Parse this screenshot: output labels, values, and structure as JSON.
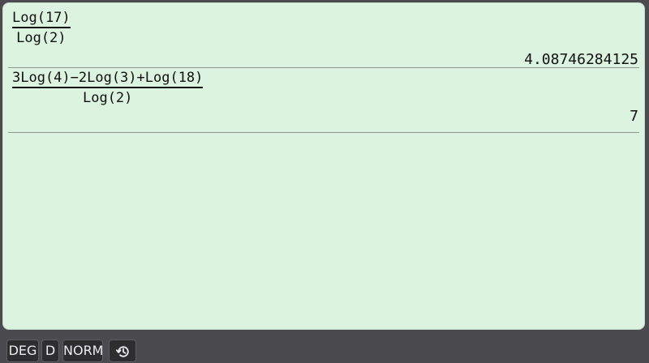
{
  "history": [
    {
      "numerator": "Log(17)",
      "denominator": "Log(2)",
      "result": "4.08746284125"
    },
    {
      "numerator": "3Log(4)−2Log(3)+Log(18)",
      "denominator": "Log(2)",
      "result": "7"
    }
  ],
  "status": {
    "angle_mode": "DEG",
    "display_mode": "D",
    "number_format": "NORM",
    "history_icon": "history-icon"
  },
  "colors": {
    "display_background": "#dcf3df",
    "frame_background": "#4b4b4f",
    "chip_background": "#2e2e31"
  }
}
